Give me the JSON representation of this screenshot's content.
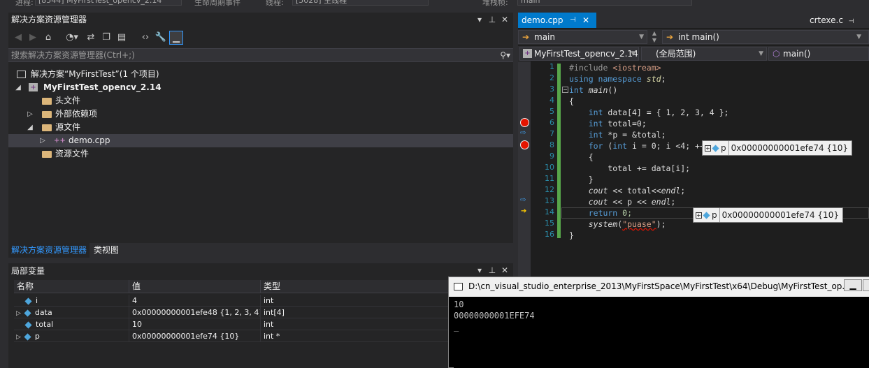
{
  "topbar": {
    "process_label": "进程:",
    "process_value": "[8544] MyFirstTest_opencv_2.14",
    "lifecycle_label": "生命周期事件",
    "thread_label": "线程:",
    "thread_value": "[5028] 主线程",
    "stackframe_label": "堆栈帧:",
    "stackframe_value": "main"
  },
  "solution_explorer": {
    "title": "解决方案资源管理器",
    "search_placeholder": "搜索解决方案资源管理器(Ctrl+;)",
    "tree": [
      {
        "label": "解决方案“MyFirstTest”(1 个项目)",
        "bold": false
      },
      {
        "label": "MyFirstTest_opencv_2.14",
        "bold": true
      },
      {
        "label": "头文件"
      },
      {
        "label": "外部依赖项"
      },
      {
        "label": "源文件"
      },
      {
        "label": "demo.cpp"
      },
      {
        "label": "资源文件"
      }
    ],
    "tabs": [
      "解决方案资源管理器",
      "类视图"
    ]
  },
  "locals": {
    "title": "局部变量",
    "columns": [
      "名称",
      "值",
      "类型"
    ],
    "rows": [
      {
        "name": "i",
        "value": "4",
        "type": "int"
      },
      {
        "name": "data",
        "value": "0x00000000001efe48 {1, 2, 3, 4}",
        "type": "int[4]"
      },
      {
        "name": "total",
        "value": "10",
        "type": "int"
      },
      {
        "name": "p",
        "value": "0x00000000001efe74 {10}",
        "type": "int *"
      }
    ]
  },
  "editor": {
    "tab_active": "demo.cpp",
    "tab_other": "crtexe.c",
    "nav_left": "main",
    "nav_right": "int main()",
    "project_combo": "MyFirstTest_opencv_2.14",
    "scope_combo": "(全局范围)",
    "member_combo": "main()",
    "line_numbers": [
      "1",
      "2",
      "3",
      "4",
      "5",
      "6",
      "7",
      "8",
      "9",
      "10",
      "11",
      "12",
      "13",
      "14",
      "15",
      "16"
    ],
    "code": {
      "l1a": "#include ",
      "l1b": "<iostream>",
      "l2a": "using namespace ",
      "l2b": "std",
      "l2c": ";",
      "l3a": "int ",
      "l3b": "main",
      "l3c": "()",
      "l4": "{",
      "l5a": "    int ",
      "l5b": "data[4] = { 1, 2, 3, 4 };",
      "l6a": "    int ",
      "l6b": "total=0;",
      "l7a": "    int ",
      "l7b": "*p = &total;",
      "l8a": "    for ",
      "l8b": "(",
      "l8c": "int ",
      "l8d": "i = 0; i <4; ++i)",
      "l9": "    {",
      "l10": "        total += data[i];",
      "l11": "    }",
      "l12a": "    ",
      "l12b": "cout",
      "l12c": " << total<<",
      "l12d": "endl",
      "l12e": ";",
      "l13a": "    ",
      "l13b": "cout",
      "l13c": " << p << ",
      "l13d": "endl",
      "l13e": ";",
      "l14a": "    return ",
      "l14b": "0;",
      "l15a": "    ",
      "l15b": "system",
      "l15c": "(",
      "l15d": "\"puase\"",
      "l15e": ");",
      "l16": "}"
    },
    "datatip_var": "p",
    "datatip_value": "0x00000000001efe74 {10}"
  },
  "console": {
    "title": "D:\\cn_visual_studio_enterprise_2013\\MyFirstSpace\\MyFirstTest\\x64\\Debug\\MyFirstTest_op...",
    "lines": [
      "10",
      "00000000001EFE74",
      "_"
    ]
  },
  "colors": {
    "accent": "#3399ff",
    "breakpoint": "#e51400",
    "keyword": "#569cd6"
  }
}
